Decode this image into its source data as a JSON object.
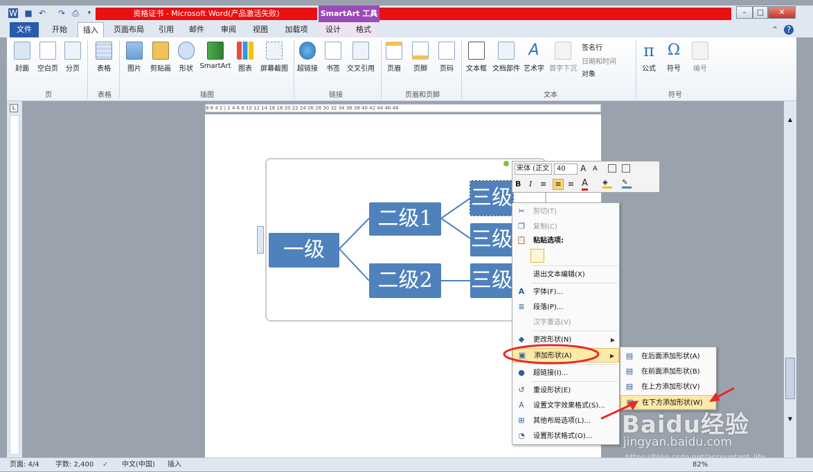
{
  "window": {
    "title": "资格证书 - Microsoft Word(产品激活失败)",
    "context_tab_group": "SmartArt 工具"
  },
  "tabs": {
    "file": "文件",
    "home": "开始",
    "insert": "插入",
    "layout": "页面布局",
    "references": "引用",
    "mailings": "邮件",
    "review": "审阅",
    "view": "视图",
    "addins": "加载项",
    "design": "设计",
    "format": "格式"
  },
  "ribbon": {
    "cover": "封面",
    "blank": "空白页",
    "pagebreak": "分页",
    "table": "表格",
    "picture": "图片",
    "clipart": "剪贴画",
    "shapes": "形状",
    "smartart": "SmartArt",
    "chart": "图表",
    "screenshot": "屏幕截图",
    "hyperlink": "超链接",
    "bookmark": "书签",
    "crossref": "交叉引用",
    "header": "页眉",
    "footer": "页脚",
    "pagenum": "页码",
    "textbox": "文本框",
    "quickparts": "文档部件",
    "wordart": "艺术字",
    "dropcap": "首字下沉",
    "signature": "签名行",
    "datetime": "日期和时间",
    "object": "对象",
    "equation": "公式",
    "symbol": "符号",
    "numbering": "编号",
    "groups": {
      "pages": "页",
      "tables": "表格",
      "illustrations": "插图",
      "links": "链接",
      "header_footer": "页眉和页脚",
      "text": "文本",
      "symbols": "符号"
    }
  },
  "ruler_ticks": "8 6 4 2 | 2 4 6 8 10 12 14 16 18 20 22 24 26 28 30 32 34 36 38 40 42 44 46 48",
  "smartart": {
    "level1": "一级",
    "level2a": "二级1",
    "level2b": "二级2",
    "level3": "三级"
  },
  "mini_toolbar": {
    "font": "宋体 (正文",
    "size": "40"
  },
  "context_menu": {
    "cut": "剪切(T)",
    "copy": "复制(C)",
    "paste_options": "粘贴选项:",
    "exit_text_edit": "退出文本编辑(X)",
    "font": "字体(F)...",
    "paragraph": "段落(P)...",
    "hanzi": "汉字重选(V)",
    "change_shape": "更改形状(N)",
    "add_shape": "添加形状(A)",
    "hyperlink": "超链接(I)...",
    "reset_shape": "重设形状(E)",
    "text_effects": "设置文字效果格式(S)...",
    "more_layout": "其他布局选项(L)...",
    "format_shape": "设置形状格式(O)..."
  },
  "submenu": {
    "after": "在后面添加形状(A)",
    "before": "在前面添加形状(B)",
    "above": "在上方添加形状(V)",
    "below": "在下方添加形状(W)"
  },
  "statusbar": {
    "page": "页面: 4/4",
    "words": "字数: 2,400",
    "lang": "中文(中国)",
    "mode": "插入",
    "zoom": "82%"
  },
  "watermark": {
    "brand": "Baidu经验",
    "site": "jingyan.baidu.com",
    "url": "https://blog.csdn.net/accountant_life"
  },
  "colors": {
    "smartart_fill": "#4f81bd",
    "annotation": "#e42b2b",
    "titlebar_accent": "#e81010",
    "context_tab": "#9a4bb8"
  }
}
